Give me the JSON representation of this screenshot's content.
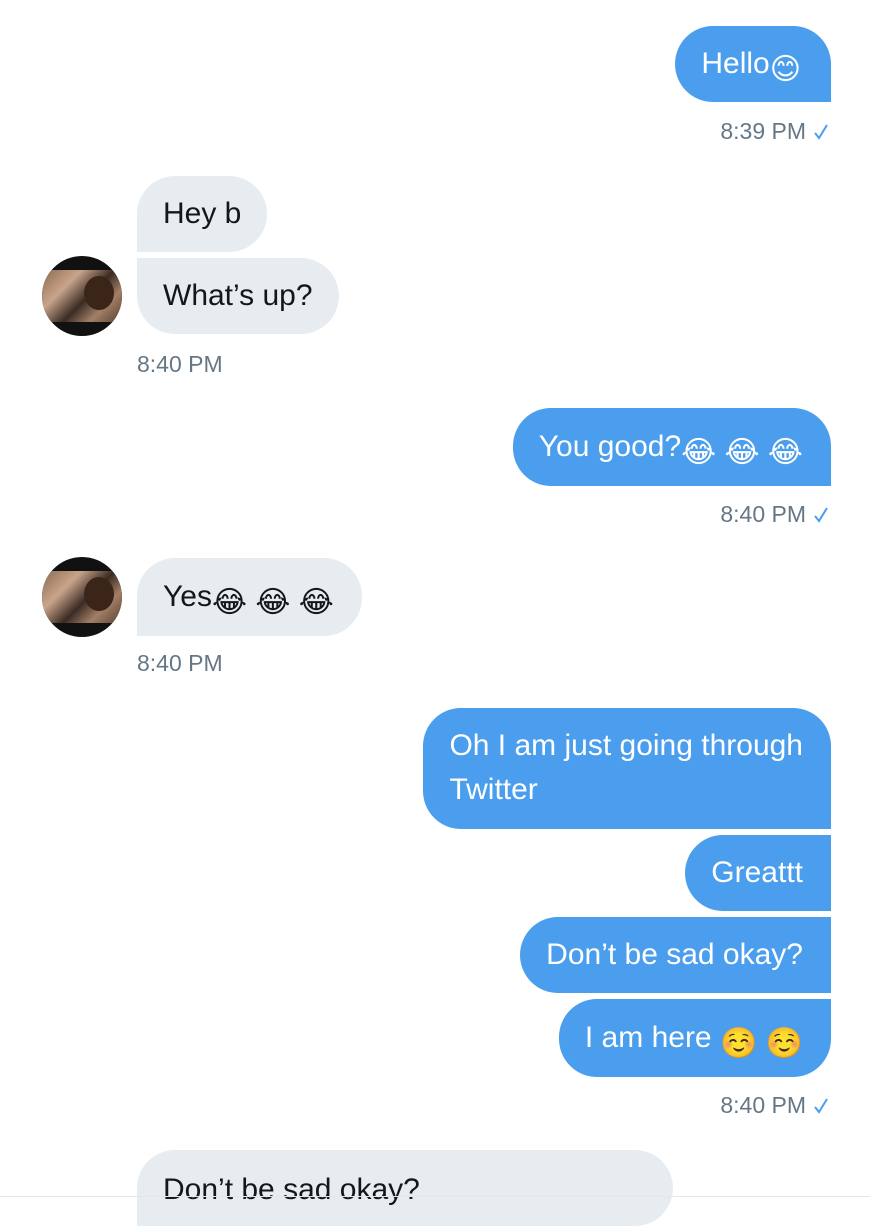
{
  "colors": {
    "outgoing_bubble": "#4a9eed",
    "incoming_bubble": "#e7ecf0",
    "timestamp": "#657786",
    "read_check": "#4a9eed"
  },
  "messages": {
    "m1": {
      "text": "Hello",
      "emoji": "😊"
    },
    "t1": {
      "time": "8:39 PM",
      "icon": "read-check-icon"
    },
    "m2": {
      "text": "Hey b"
    },
    "m3": {
      "text": "What’s up?"
    },
    "t2": {
      "time": "8:40 PM"
    },
    "m4": {
      "text": "You good?",
      "emoji": "😂 😂 😂"
    },
    "t3": {
      "time": "8:40 PM",
      "icon": "read-check-icon"
    },
    "m5": {
      "text": "Yes",
      "emoji": "😂 😂 😂"
    },
    "t4": {
      "time": "8:40 PM"
    },
    "m6": {
      "line1": "Oh I am just going through",
      "line2": "Twitter"
    },
    "m7": {
      "text": "Greattt"
    },
    "m8": {
      "text": "Don’t be sad okay?"
    },
    "m9": {
      "text": "I am here ",
      "emoji": "☺️ ☺️"
    },
    "t5": {
      "time": "8:40 PM",
      "icon": "read-check-icon"
    },
    "m10": {
      "text": "Don’t be sad okay?"
    }
  }
}
